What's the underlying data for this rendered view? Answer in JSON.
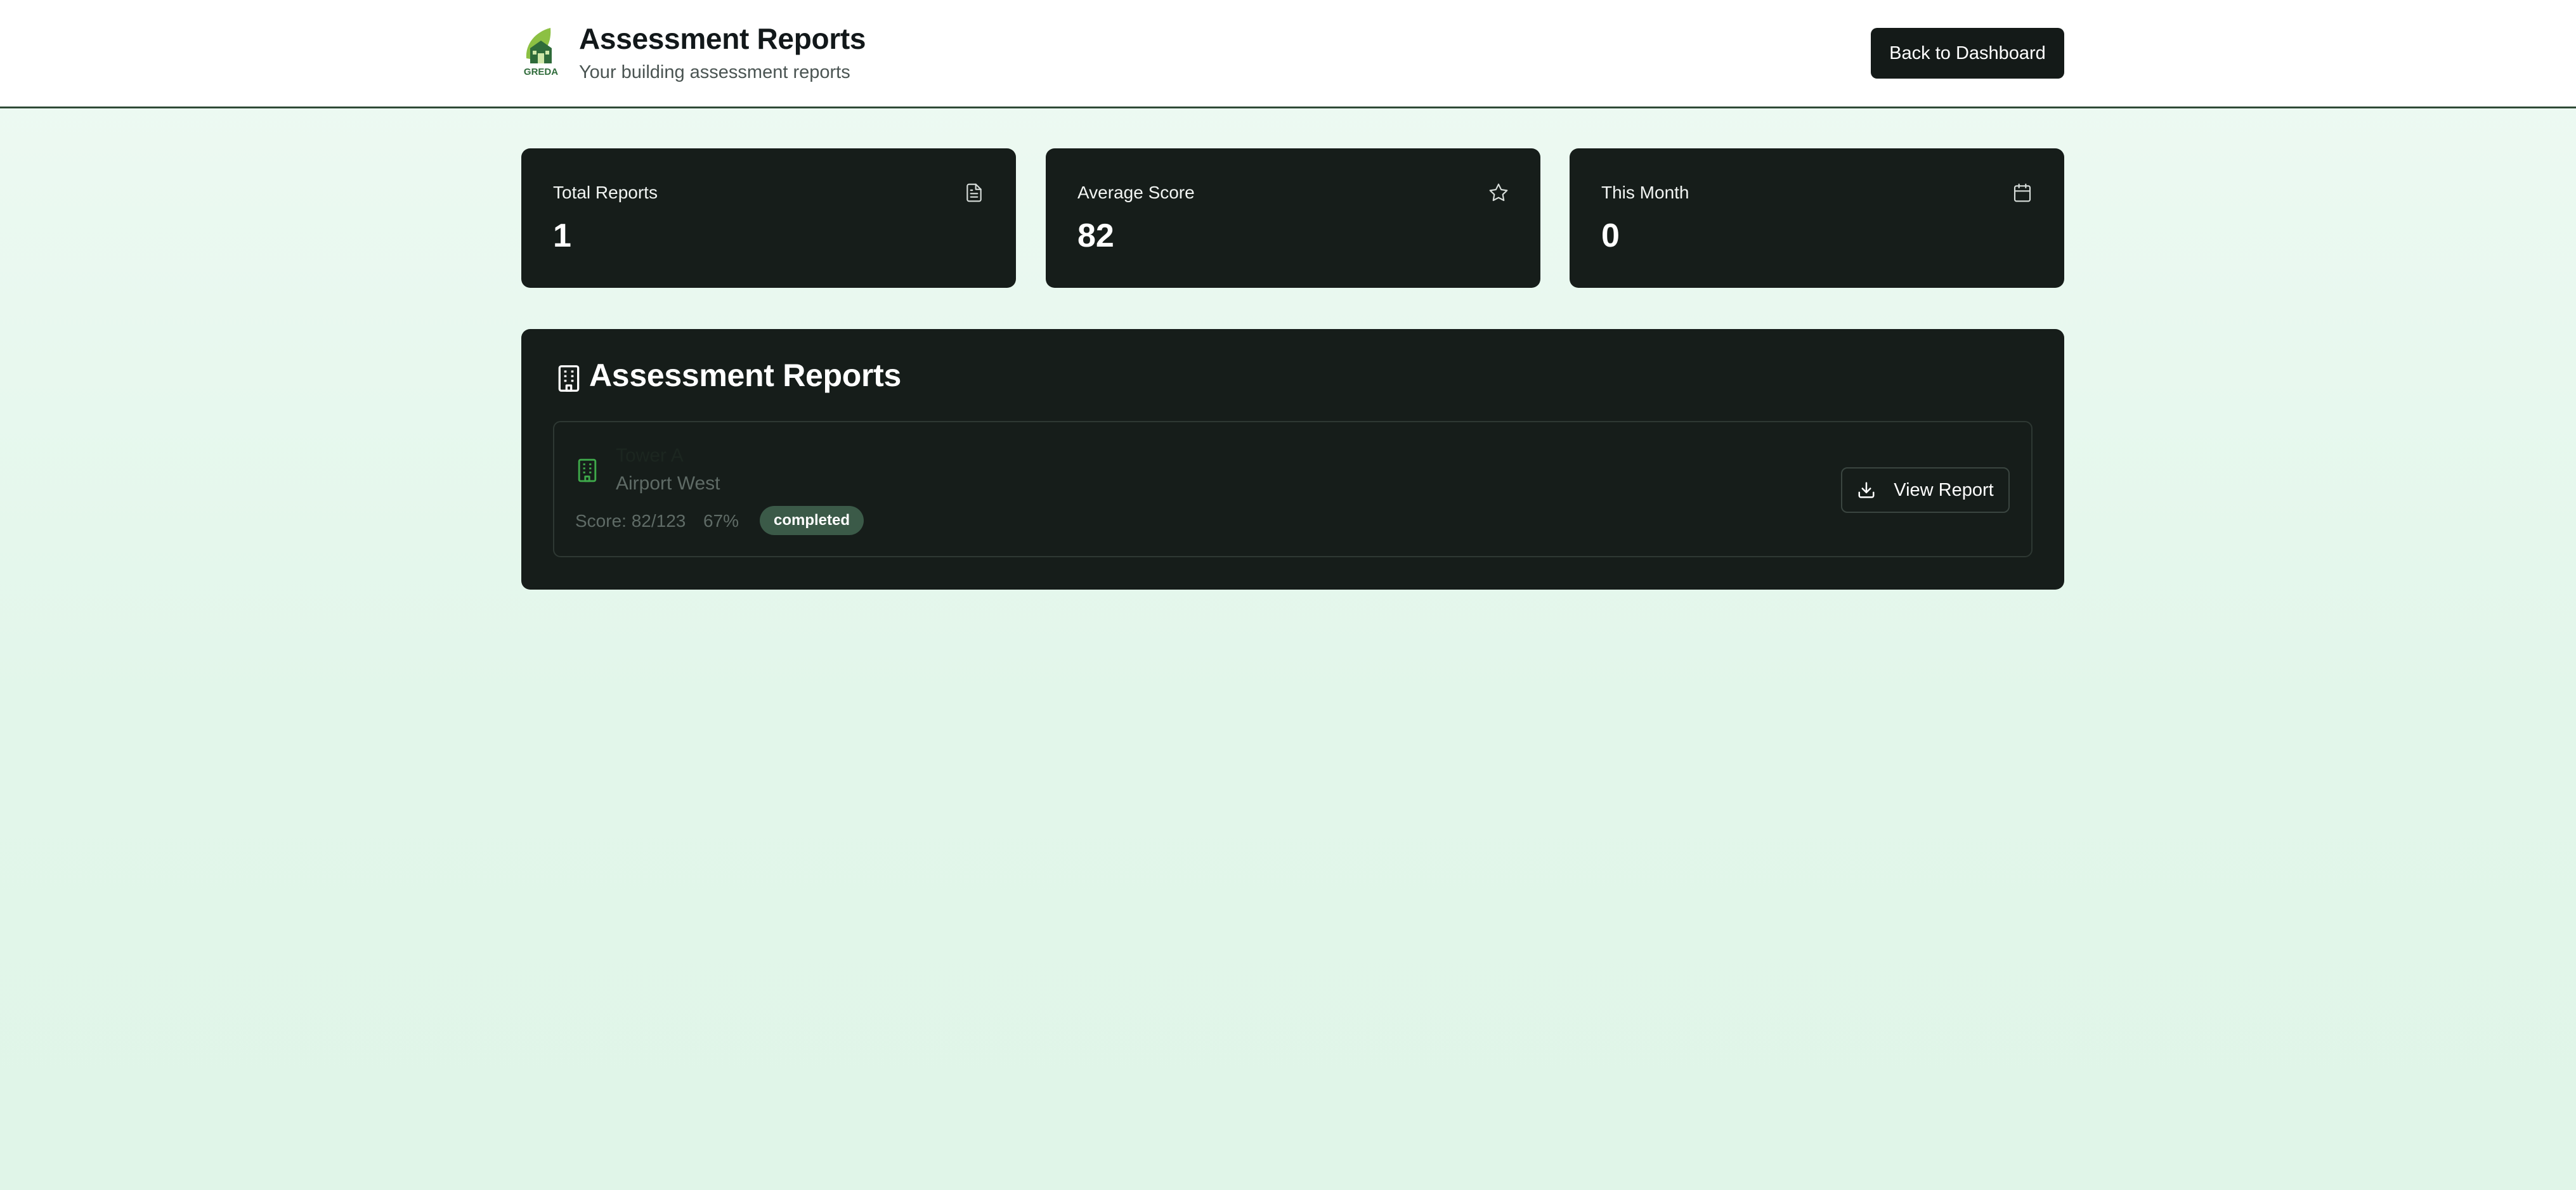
{
  "header": {
    "title": "Assessment Reports",
    "subtitle": "Your building assessment reports",
    "logo_text": "GREDA",
    "back_label": "Back to Dashboard"
  },
  "stats": [
    {
      "label": "Total Reports",
      "value": "1",
      "icon": "document-icon"
    },
    {
      "label": "Average Score",
      "value": "82",
      "icon": "star-icon"
    },
    {
      "label": "This Month",
      "value": "0",
      "icon": "calendar-icon"
    }
  ],
  "reports": {
    "title": "Assessment Reports",
    "icon": "building-icon",
    "items": [
      {
        "name": "Tower A",
        "location": "Airport West",
        "score": "Score: 82/123",
        "percent": "67%",
        "status": "completed",
        "action_label": "View Report"
      }
    ]
  },
  "colors": {
    "accent": "#141a18",
    "card_bg": "#161d1a",
    "badge_bg": "#3b5a48",
    "header_border": "#2f4a36",
    "icon_green": "#3ea84a"
  }
}
